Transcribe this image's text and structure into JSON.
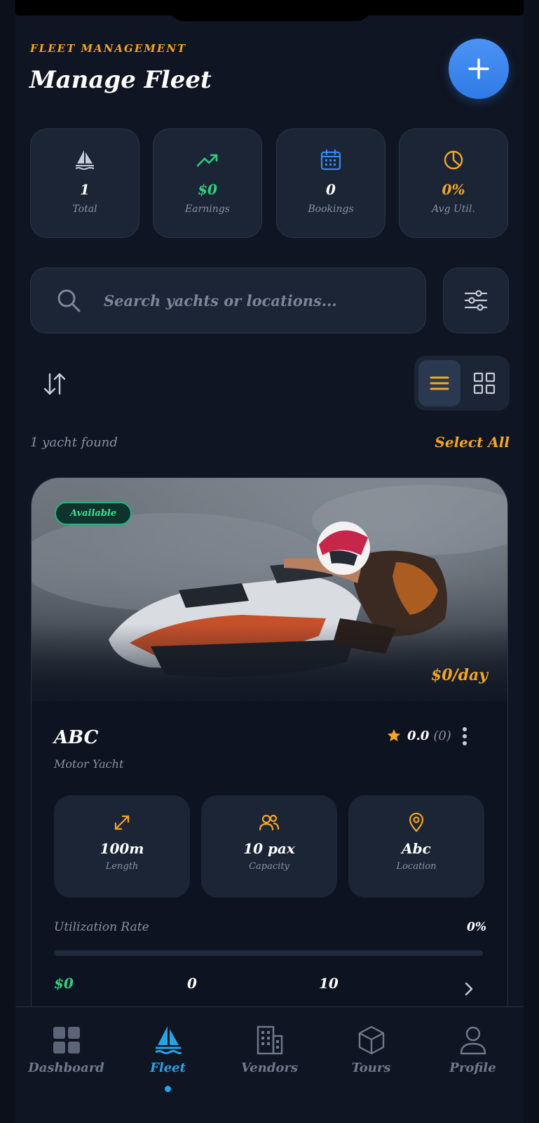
{
  "header": {
    "eyebrow": "FLEET MANAGEMENT",
    "title": "Manage Fleet",
    "add_icon": "plus-icon"
  },
  "stats": [
    {
      "icon": "sailboat-icon",
      "value": "1",
      "label": "Total",
      "color": "#ffffff"
    },
    {
      "icon": "trending-up-icon",
      "value": "$0",
      "label": "Earnings",
      "color": "#2ed07f"
    },
    {
      "icon": "calendar-icon",
      "value": "0",
      "label": "Bookings",
      "color": "#ffffff"
    },
    {
      "icon": "pie-chart-icon",
      "value": "0%",
      "label": "Avg Util.",
      "color": "#f5a623"
    }
  ],
  "search": {
    "placeholder": "Search yachts or locations...",
    "value": ""
  },
  "results": {
    "count_text": "1 yacht found",
    "select_all": "Select All"
  },
  "yacht": {
    "status": "Available",
    "price": "$0/day",
    "name": "ABC",
    "type": "Motor Yacht",
    "rating": "0.0",
    "reviews": "(0)",
    "specs": [
      {
        "icon": "resize-icon",
        "value": "100m",
        "label": "Length"
      },
      {
        "icon": "users-icon",
        "value": "10 pax",
        "label": "Capacity"
      },
      {
        "icon": "map-pin-icon",
        "value": "Abc",
        "label": "Location"
      }
    ],
    "utilization_label": "Utilization Rate",
    "utilization_value": "0%",
    "utilization_fraction": 0,
    "metrics": [
      "$0",
      "0",
      "10"
    ]
  },
  "nav": [
    {
      "icon": "grid-icon",
      "label": "Dashboard",
      "active": false
    },
    {
      "icon": "sailboat-icon",
      "label": "Fleet",
      "active": true
    },
    {
      "icon": "building-icon",
      "label": "Vendors",
      "active": false
    },
    {
      "icon": "box-icon",
      "label": "Tours",
      "active": false
    },
    {
      "icon": "user-icon",
      "label": "Profile",
      "active": false
    }
  ],
  "colors": {
    "accent": "#f5a623",
    "primary": "#3a87f0",
    "success": "#2ed07f",
    "nav_active": "#29a3e8",
    "background": "#0f1522",
    "card": "#1b2535"
  }
}
